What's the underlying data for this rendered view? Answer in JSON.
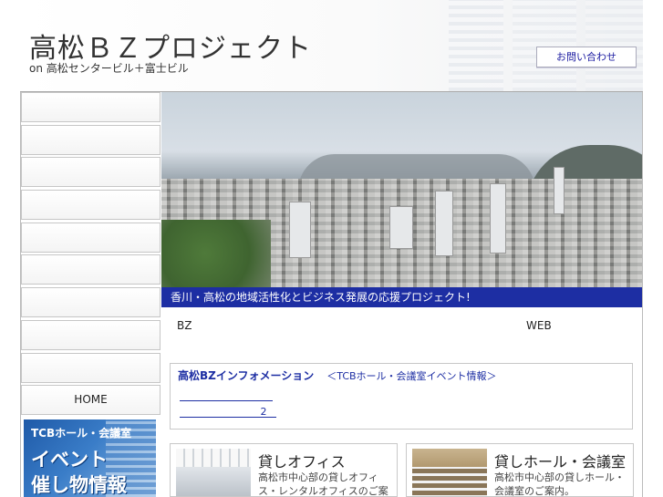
{
  "header": {
    "title": "高松ＢＺプロジェクト",
    "subtitle": "on 高松センタービル＋富士ビル",
    "contact_label": "お問い合わせ"
  },
  "sidebar": {
    "items": [
      {
        "label": ""
      },
      {
        "label": ""
      },
      {
        "label": ""
      },
      {
        "label": ""
      },
      {
        "label": ""
      },
      {
        "label": ""
      },
      {
        "label": ""
      },
      {
        "label": ""
      },
      {
        "label": ""
      },
      {
        "label": "HOME"
      }
    ],
    "banner": {
      "line1": "TCBホール・会議室",
      "line2": "イベント",
      "line3": "催し物情報"
    }
  },
  "hero": {
    "caption": "香川・高松の地域活性化とビジネス発展の応援プロジェクト!"
  },
  "labels": {
    "bz": "BZ",
    "web": "WEB"
  },
  "info": {
    "title": "高松BZインフォメーション",
    "subtitle": "＜TCBホール・会議室イベント情報＞",
    "link1": "",
    "link2": "2"
  },
  "cards": [
    {
      "title": "貸しオフィス",
      "desc": "高松市中心部の貸しオフィス・レンタルオフィスのご案内。"
    },
    {
      "title": "貸しホール・会議室",
      "desc": "高松市中心部の貸しホール・会議室のご案内。"
    }
  ],
  "colors": {
    "accent_blue": "#1d2ea3",
    "link_blue": "#1a1aa0"
  }
}
